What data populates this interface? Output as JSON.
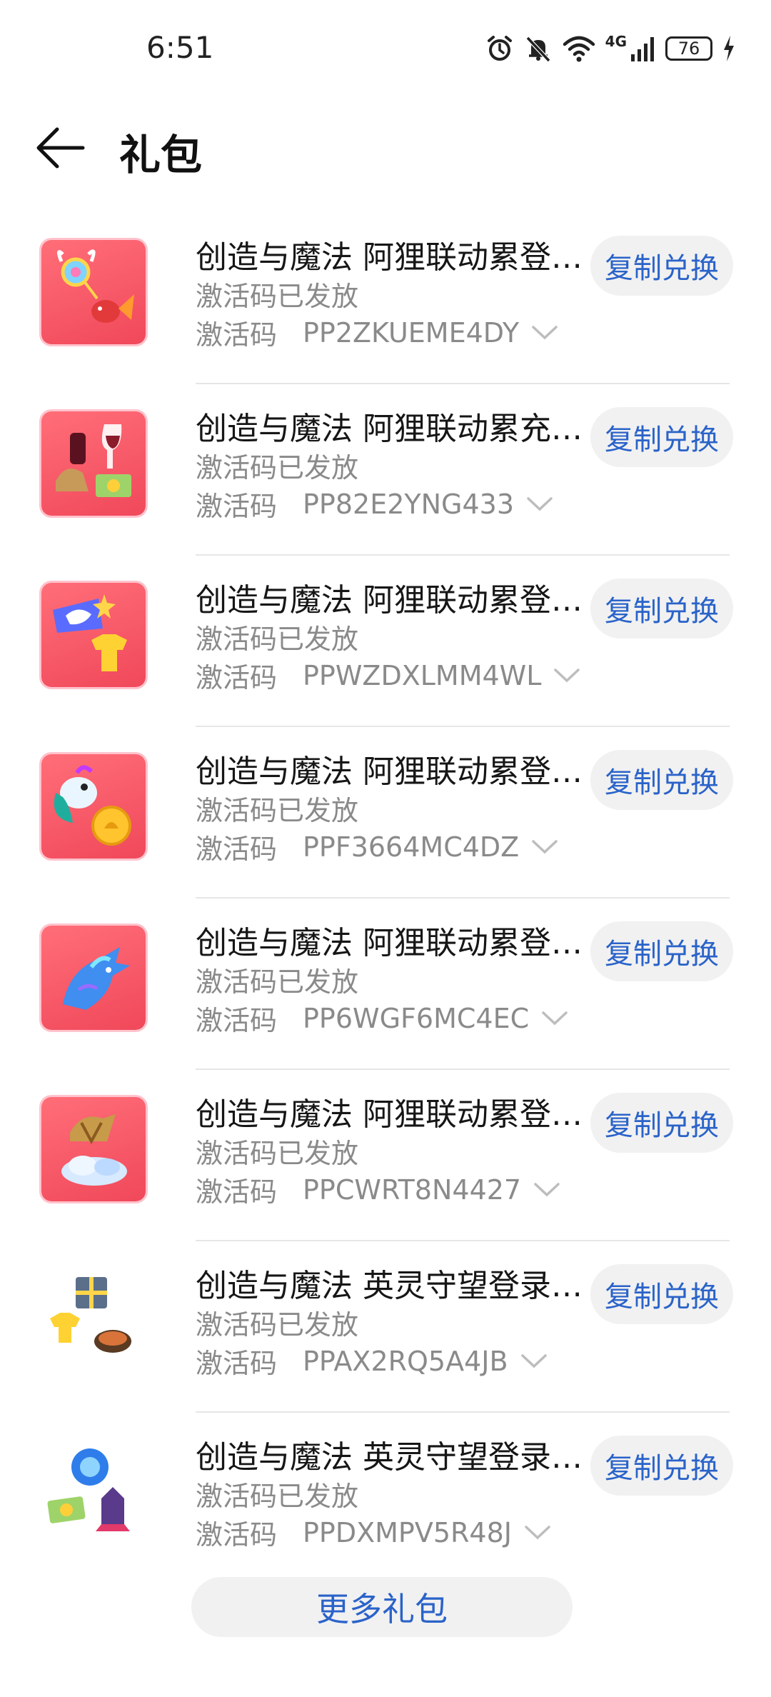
{
  "status_bar": {
    "time": "6:51",
    "network": "4G",
    "battery": "76",
    "icons": [
      "alarm-icon",
      "mute-icon",
      "wifi-icon",
      "signal-icon",
      "battery-icon",
      "charging-icon"
    ]
  },
  "header": {
    "title": "礼包",
    "back_icon": "back-arrow-icon"
  },
  "common": {
    "status_text": "激活码已发放",
    "code_label": "激活码",
    "button_label": "复制兑换"
  },
  "items": [
    {
      "title": "创造与魔法 阿狸联动累登礼包",
      "code": "PP2ZKUEME4DY",
      "icon": "gift-icon-lollipop-fish"
    },
    {
      "title": "创造与魔法 阿狸联动累充礼包",
      "code": "PP82E2YNG433",
      "icon": "gift-icon-wine-hat"
    },
    {
      "title": "创造与魔法 阿狸联动累登礼包",
      "code": "PPWZDXLMM4WL",
      "icon": "gift-icon-unicorn-shirt"
    },
    {
      "title": "创造与魔法 阿狸联动累登礼包",
      "code": "PPF3664MC4DZ",
      "icon": "gift-icon-parrot-coin"
    },
    {
      "title": "创造与魔法 阿狸联动累登礼包",
      "code": "PP6WGF6MC4EC",
      "icon": "gift-icon-dragon"
    },
    {
      "title": "创造与魔法 阿狸联动累登礼包",
      "code": "PPCWRT8N4427",
      "icon": "gift-icon-hat-cloud"
    },
    {
      "title": "创造与魔法 英灵守望登录礼包",
      "code": "PPAX2RQ5A4JB",
      "icon": "gift-icon-box-shirt-food"
    },
    {
      "title": "创造与魔法 英灵守望登录礼包",
      "code": "PPDXMPV5R48J",
      "icon": "gift-icon-orb-ticket-rocket"
    }
  ],
  "footer": {
    "more_label": "更多礼包"
  },
  "colors": {
    "accent": "#2a63c9",
    "button_bg": "#f1f1f1",
    "icon_bg": "#f0485a"
  }
}
